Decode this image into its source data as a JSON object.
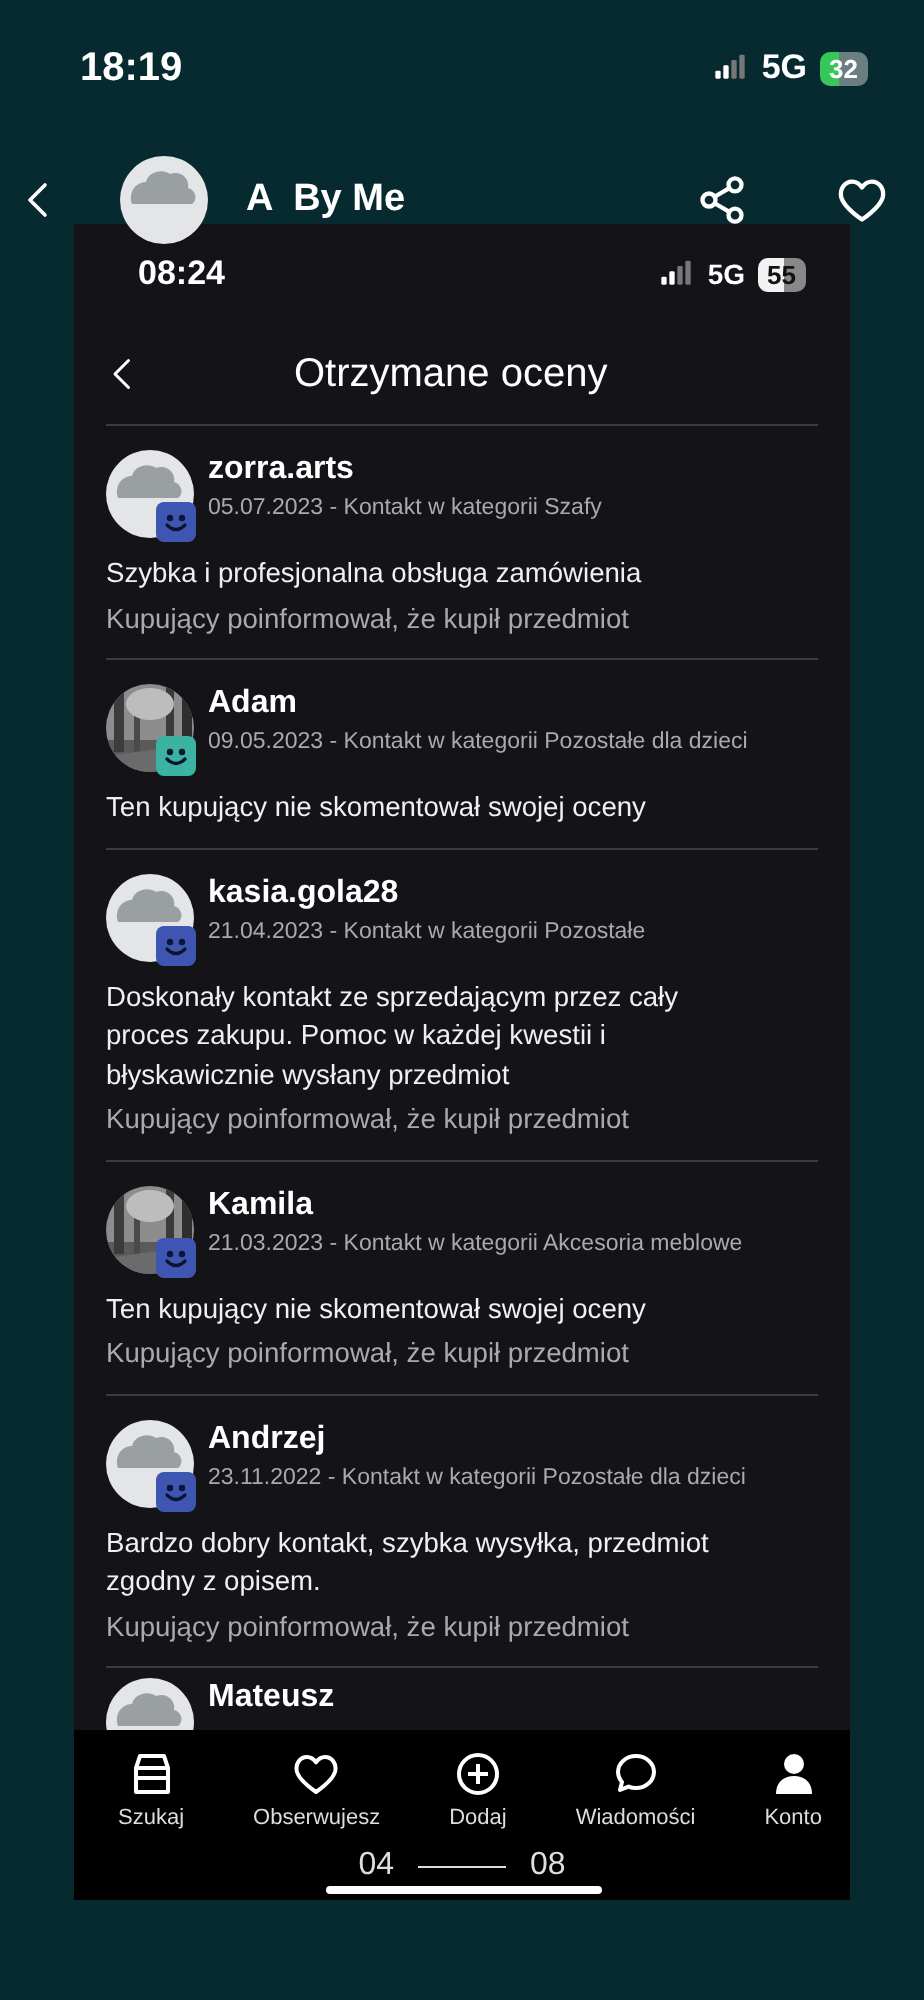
{
  "status_bar": {
    "time": "18:19",
    "network": "5G",
    "battery": "32"
  },
  "header": {
    "title": "A  By Me",
    "avatar": {
      "kind": "placeholder"
    }
  },
  "screenshot": {
    "status_bar": {
      "time": "08:24",
      "network": "5G",
      "battery": "55"
    },
    "title": "Otrzymane oceny",
    "reviews": [
      {
        "name": "zorra.arts",
        "meta": "05.07.2023 - Kontakt w kategorii Szafy",
        "avatar": {
          "kind": "placeholder"
        },
        "color": "#3e56b1",
        "comment": "Szybka i profesjonalna obsługa zamówienia",
        "note": "Kupujący poinformował, że kupił przedmiot"
      },
      {
        "name": "Adam",
        "meta": "09.05.2023 - Kontakt w kategorii Pozostałe dla dzieci",
        "color": "#3bb3a3",
        "comment": "Ten kupujący nie skomentował swojej oceny"
      },
      {
        "name": "kasia.gola28",
        "meta": "21.04.2023 - Kontakt w kategorii Pozostałe",
        "avatar": {
          "kind": "placeholder"
        },
        "color": "#3e56b1",
        "comment": "Doskonały kontakt ze sprzedającym przez cały proces zakupu. Pomoc w każdej kwestii i błyskawicznie wysłany przedmiot",
        "note": "Kupujący poinformował, że kupił przedmiot"
      },
      {
        "name": "Kamila",
        "meta": "21.03.2023 - Kontakt w kategorii Akcesoria meblowe",
        "color": "#3e56b1",
        "comment": "Ten kupujący nie skomentował swojej oceny",
        "note": "Kupujący poinformował, że kupił przedmiot"
      },
      {
        "name": "Andrzej",
        "meta": "23.11.2022 - Kontakt w kategorii Pozostałe dla dzieci",
        "avatar": {
          "kind": "placeholder"
        },
        "color": "#3e56b1",
        "comment": "Bardzo dobry kontakt, szybka wysyłka, przedmiot zgodny z opisem.",
        "note": "Kupujący poinformował, że kupił przedmiot"
      },
      {
        "name": "Mateusz",
        "avatar": {
          "kind": "placeholder"
        }
      }
    ],
    "nav": [
      {
        "label": "Szukaj",
        "kind": "store"
      },
      {
        "label": "Obserwujesz",
        "kind": "heart"
      },
      {
        "label": "Dodaj",
        "kind": "plus"
      },
      {
        "label": "Wiadomości",
        "kind": "chat"
      },
      {
        "label": "Konto",
        "kind": "person"
      }
    ],
    "scrubber": {
      "start": "04",
      "end": "08"
    }
  }
}
